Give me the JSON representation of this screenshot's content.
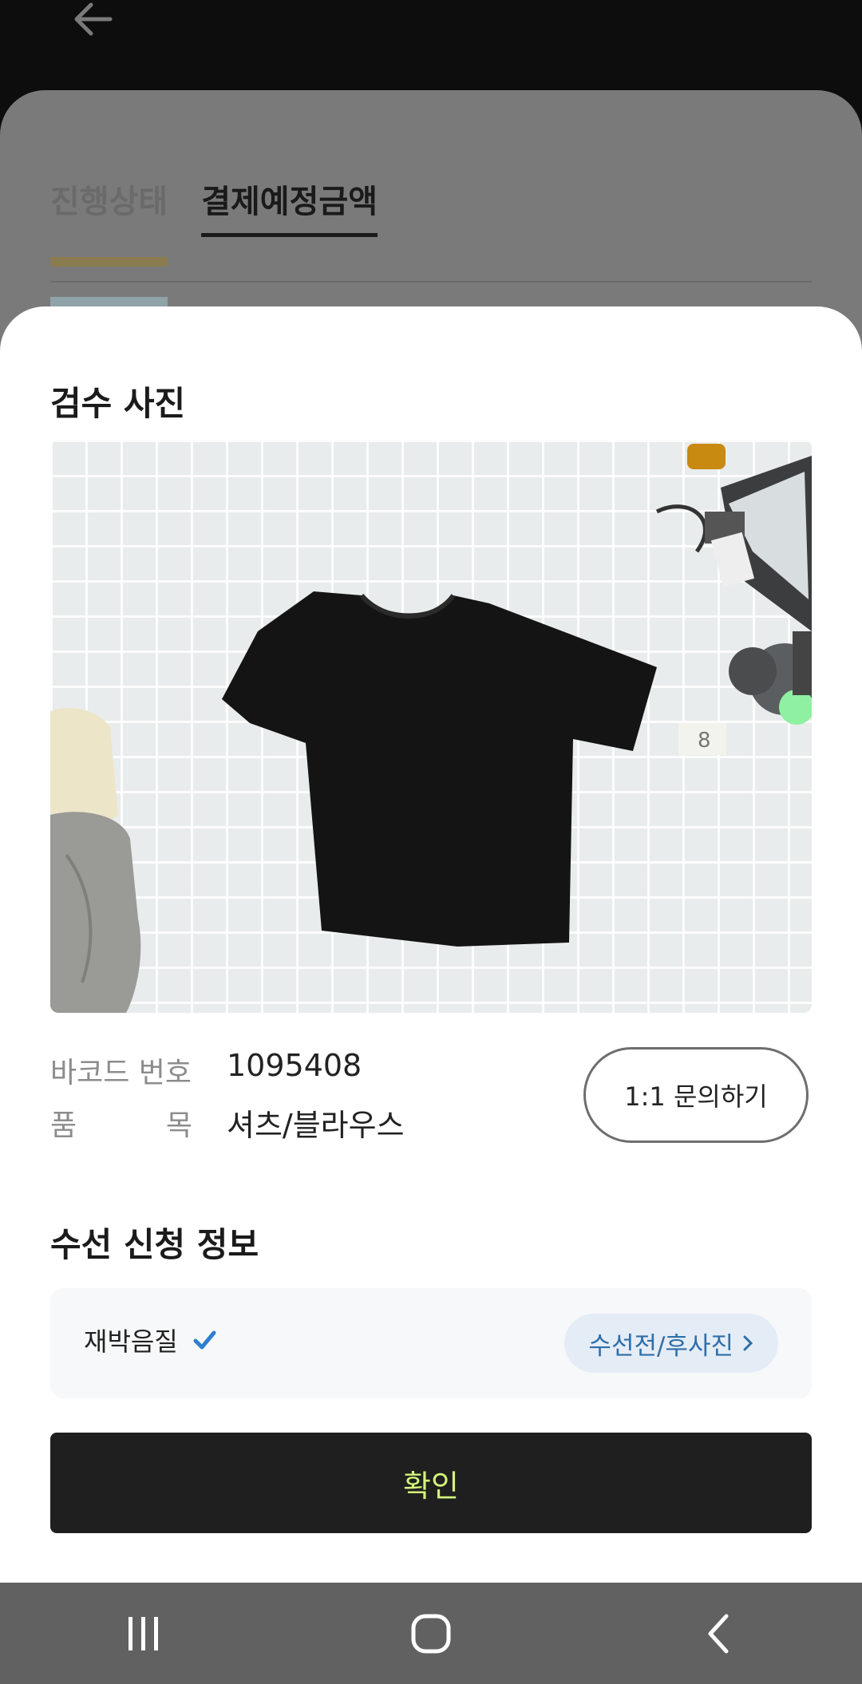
{
  "background": {
    "tabs": [
      {
        "label": "진행상태"
      },
      {
        "label": "결제예정금액"
      }
    ]
  },
  "modal": {
    "photo_section_title": "검수 사진",
    "photo_marker": "8",
    "barcode_label": "바코드 번호",
    "barcode_value": "1095408",
    "item_label_a": "품",
    "item_label_b": "목",
    "item_value": "셔츠/블라우스",
    "inquiry_button": "1:1 문의하기",
    "repair_section_title": "수선 신청 정보",
    "repair_item": "재박음질",
    "repair_photo_chip": "수선전/후사진",
    "confirm_button": "확인"
  },
  "colors": {
    "accent_confirm_text": "#d4f27a",
    "chip_text": "#2f6ea8",
    "check": "#2f7fd0"
  },
  "icons": [
    "back-arrow-icon",
    "check-icon",
    "chevron-right-icon",
    "recent-apps-icon",
    "home-icon",
    "back-icon"
  ]
}
